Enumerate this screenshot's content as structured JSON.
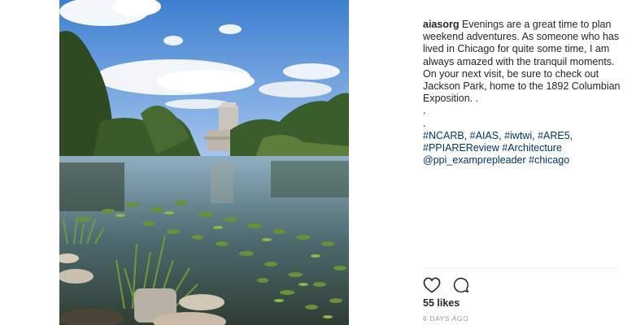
{
  "post": {
    "username": "aiasorg",
    "caption_text": "Evenings are a great time to plan weekend adventures. As someone who has lived in Chicago for quite some time, I am always amazed with the tranquil moments. On your next visit, be sure to check out Jackson Park, home to the 1892 Columbian Exposition. .",
    "dots": [
      ".",
      "."
    ],
    "hashtags": [
      "#NCARB",
      "#AIAS",
      "#iwtwi",
      "#ARE5",
      "#PPIAREReview",
      "#Architecture",
      "@ppi_examprepleader",
      "#chicago"
    ],
    "likes": "55 likes",
    "time": "6 DAYS AGO"
  },
  "icons": {
    "like": "heart-icon",
    "comment": "comment-icon"
  },
  "colors": {
    "link": "#003569",
    "muted": "#999999",
    "text": "#262626"
  }
}
